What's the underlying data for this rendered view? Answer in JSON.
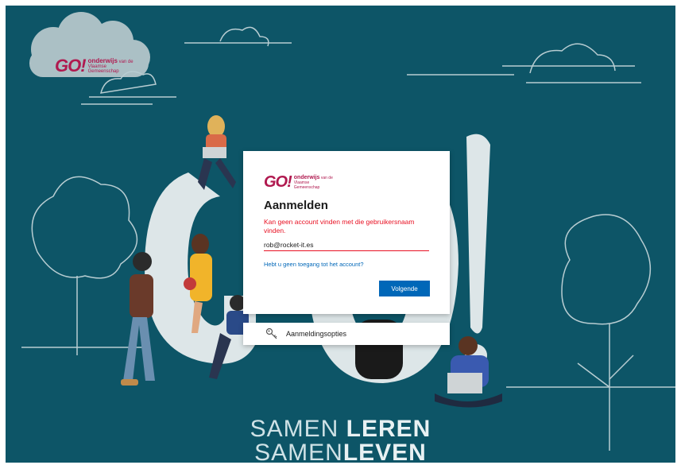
{
  "brand": {
    "logo_mark": "GO!",
    "logo_line1": "onderwijs",
    "logo_line1_suffix": "van de",
    "logo_line2": "Vlaamse Gemeenschap",
    "primary_color": "#b0194f",
    "background_color": "#0d5567"
  },
  "signin": {
    "title": "Aanmelden",
    "error": "Kan geen account vinden met die gebruikersnaam vinden.",
    "username_value": "rob@rocket-it.es",
    "no_access_link": "Hebt u geen toegang tot het account?",
    "next_label": "Volgende",
    "accent_color": "#0067b8",
    "error_color": "#e81123"
  },
  "options": {
    "label": "Aanmeldingsopties",
    "icon": "key-icon"
  },
  "slogan": {
    "line1_a": "SAMEN ",
    "line1_b": "LEREN",
    "line2_a": "SAMEN",
    "line2_b": "LEVEN"
  }
}
